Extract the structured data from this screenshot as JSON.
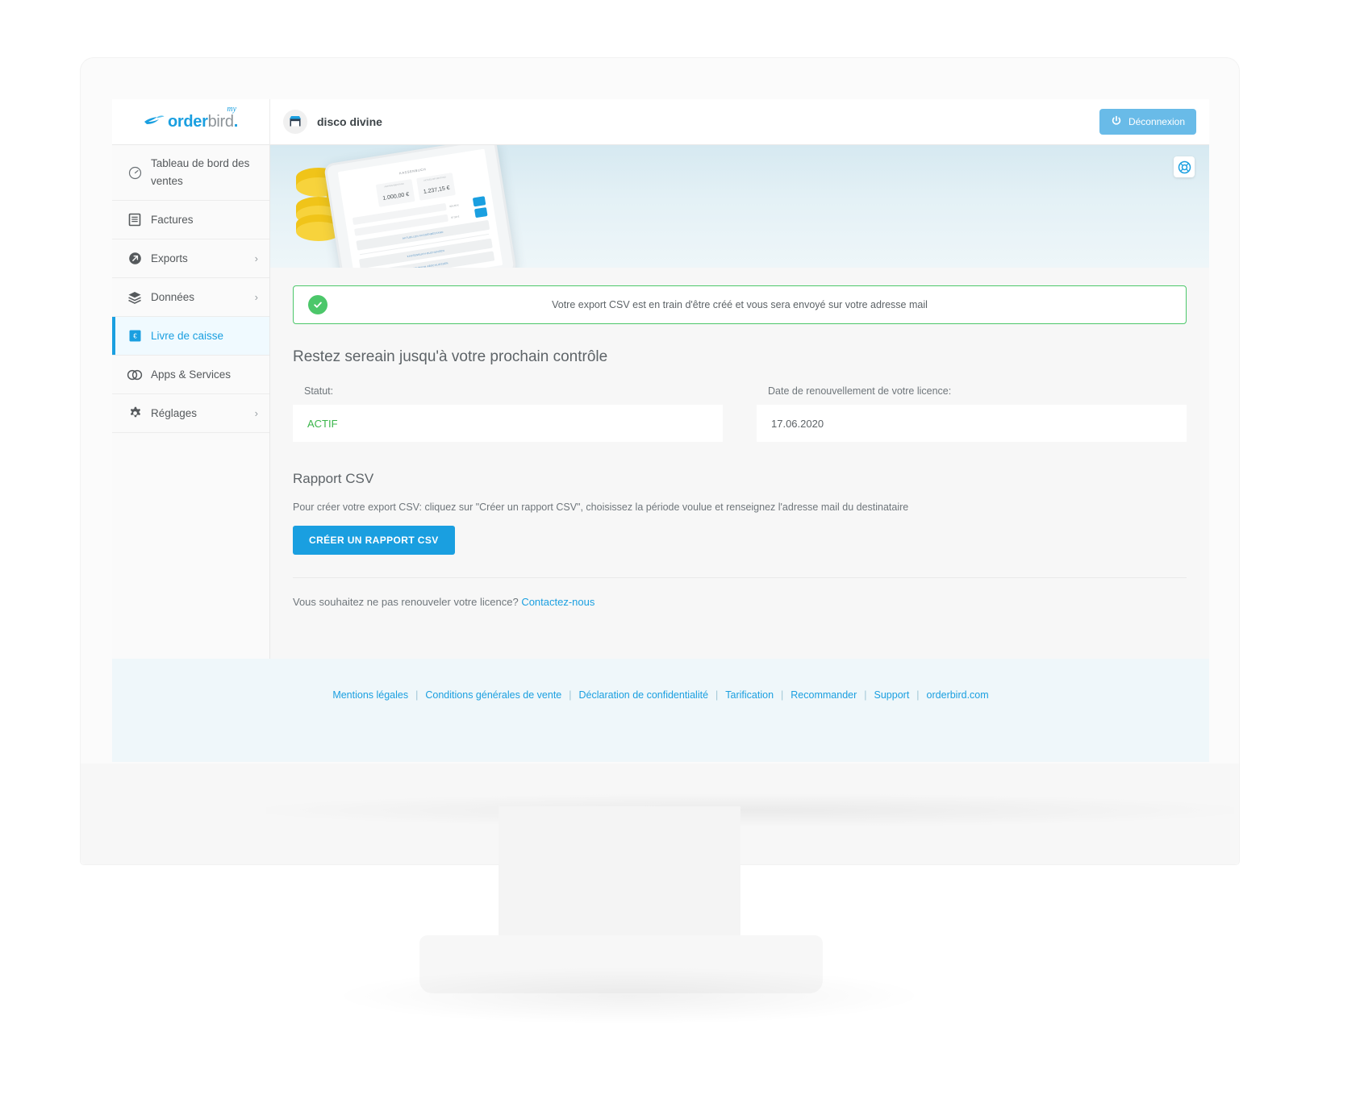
{
  "brand": {
    "logo_my": "my",
    "logo_order": "order",
    "logo_bird": "bird",
    "logo_dot": ".",
    "bird_icon": "bird-icon"
  },
  "topbar": {
    "shop_icon": "shop-icon",
    "shop_name": "disco divine",
    "logout_label": "Déconnexion",
    "power_icon": "power-icon"
  },
  "sidebar": {
    "items": [
      {
        "label": "Tableau de bord des ventes",
        "icon": "gauge-icon",
        "chevron": "",
        "active": false
      },
      {
        "label": "Factures",
        "icon": "receipt-icon",
        "chevron": "",
        "active": false
      },
      {
        "label": "Exports",
        "icon": "export-arrow-icon",
        "chevron": "›",
        "active": false
      },
      {
        "label": "Données",
        "icon": "layers-icon",
        "chevron": "›",
        "active": false
      },
      {
        "label": "Livre de caisse",
        "icon": "cashbook-icon",
        "chevron": "",
        "active": true
      },
      {
        "label": "Apps & Services",
        "icon": "rings-icon",
        "chevron": "",
        "active": false
      },
      {
        "label": "Réglages",
        "icon": "gear-icon",
        "chevron": "›",
        "active": false
      }
    ]
  },
  "hero": {
    "help_icon": "lifebuoy-icon",
    "tablet_title": "KASSENBUCH",
    "amount_left_caption": "ANFANGSBESTAND",
    "amount_left": "1.000,00 €",
    "amount_right_caption": "AKTUELLER BESTAND",
    "amount_right": "1.237,15 €",
    "row_income_value": "324,65 €",
    "row_expense_value": "87,50 €",
    "bar_1": "AKTUELLEN KASSENBESTAND",
    "bar_2": "KASSENBUCH-BUCHUNGEN",
    "bar_3": "KASSENBUCH ABSCHLIESSEN"
  },
  "alert": {
    "icon": "check-circle-icon",
    "message": "Votre export CSV est en train d'être créé et vous sera envoyé sur votre adresse mail",
    "accent_color": "#4cc76a"
  },
  "main": {
    "section_title": "Restez sereain jusqu'à votre prochain contrôle",
    "status_label": "Statut:",
    "status_value": "ACTIF",
    "status_color": "#3ab54a",
    "renewal_label": "Date de renouvellement de votre licence:",
    "renewal_value": "17.06.2020",
    "csv_title": "Rapport CSV",
    "csv_help": "Pour créer votre export CSV: cliquez sur \"Créer un rapport CSV\", choisissez la période voulue et renseignez l'adresse mail du destinataire",
    "csv_button": "CRÉER UN RAPPORT CSV",
    "renew_question": "Vous souhaitez ne pas renouveler votre licence?",
    "renew_link": "Contactez-nous"
  },
  "footer": {
    "links": [
      "Mentions légales",
      "Conditions générales de vente",
      "Déclaration de confidentialité",
      "Tarification",
      "Recommander",
      "Support",
      "orderbird.com"
    ],
    "separator": "|"
  },
  "colors": {
    "accent": "#1a9fe0",
    "logout": "#69bbe8",
    "success": "#4cc76a",
    "footer_bg": "#eff7fa"
  }
}
